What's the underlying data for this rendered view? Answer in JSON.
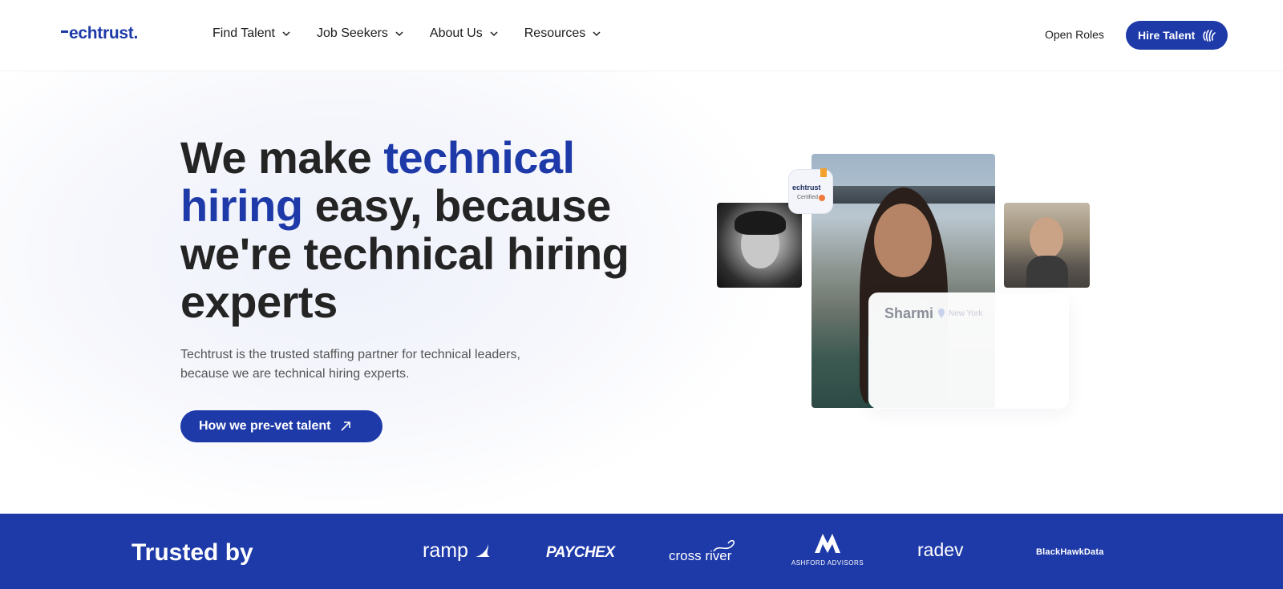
{
  "nav": {
    "logo": "echtrust.",
    "menu": [
      {
        "label": "Find Talent"
      },
      {
        "label": "Job Seekers"
      },
      {
        "label": "About Us"
      },
      {
        "label": "Resources"
      }
    ],
    "open_roles": "Open Roles",
    "hire_talent": "Hire Talent"
  },
  "hero": {
    "title_part1": "We make ",
    "title_blue1": "technical",
    "title_blue2": "hiring",
    "title_part2": " easy, because we're technical hiring experts",
    "subtitle": "Techtrust is the trusted staffing partner for technical leaders, because we are technical hiring experts.",
    "cta": "How we pre-vet talent",
    "badge": {
      "brand": "echtrust",
      "label": "Certified"
    },
    "profile": {
      "name": "Sharmi",
      "location": "New York"
    }
  },
  "trusted": {
    "title": "Trusted by",
    "logos": [
      "ramp",
      "PAYCHEX",
      "cross river",
      "ASHFORD ADVISORS",
      "radev",
      "BlackHawkData"
    ]
  },
  "colors": {
    "brand": "#1e3aa8",
    "text": "#242424",
    "badge_dot": "#f07a3a"
  }
}
